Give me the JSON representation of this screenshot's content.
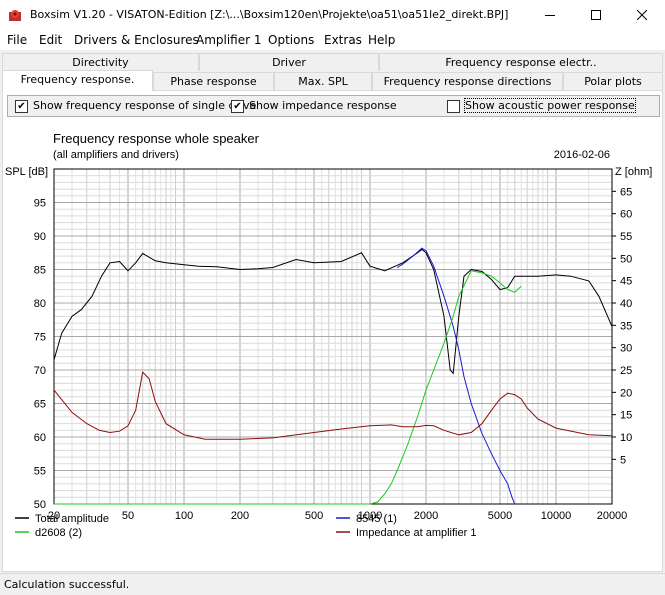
{
  "window": {
    "title": "Boxsim V1.20 - VISATON-Edition [Z:\\...\\Boxsim120en\\Projekte\\oa51\\oa51le2_direkt.BPJ]",
    "minimize": "—",
    "maximize": "☐",
    "close": "✕"
  },
  "menu": {
    "items": [
      {
        "label": "File"
      },
      {
        "label": "Edit"
      },
      {
        "label": "Drivers & Enclosures"
      },
      {
        "label": "Amplifier 1"
      },
      {
        "label": "Options"
      },
      {
        "label": "Extras"
      },
      {
        "label": "Help"
      }
    ]
  },
  "tabs": {
    "row1": [
      {
        "label": "Directivity"
      },
      {
        "label": "Driver"
      },
      {
        "label": "Frequency response electr.."
      }
    ],
    "row2": [
      {
        "label": "Frequency response."
      },
      {
        "label": "Phase response"
      },
      {
        "label": "Max. SPL"
      },
      {
        "label": "Frequency response directions"
      },
      {
        "label": "Polar plots"
      }
    ]
  },
  "options": {
    "single_drive": {
      "label": "Show frequency response of single drive",
      "checked": true
    },
    "impedance": {
      "label": "Show impedance response",
      "checked": true
    },
    "acoustic_power": {
      "label": "Show acoustic power response",
      "checked": false
    }
  },
  "status": {
    "text": "Calculation successful."
  },
  "chart_data": {
    "type": "line",
    "title": "Frequency response whole speaker",
    "subtitle": "(all amplifiers and drivers)",
    "date": "2016-02-06",
    "ylabel": "SPL [dB]",
    "y2label": "Z [ohm]",
    "xscale": "log",
    "xlim": [
      20,
      20000
    ],
    "ylim": [
      50,
      100
    ],
    "y2lim": [
      -5,
      70
    ],
    "grid": true,
    "legend_position": "bottom",
    "x_ticks": [
      "20",
      "50",
      "100",
      "200",
      "500",
      "1000",
      "2000",
      "5000",
      "10000",
      "20000"
    ],
    "y_ticks": [
      "50",
      "55",
      "60",
      "65",
      "70",
      "75",
      "80",
      "85",
      "90",
      "95"
    ],
    "y2_ticks": [
      "5",
      "10",
      "15",
      "20",
      "25",
      "30",
      "35",
      "40",
      "45",
      "50",
      "55",
      "60",
      "65"
    ],
    "series": [
      {
        "name": "Total amplitude",
        "axis": "spl",
        "color": "#000000",
        "x": [
          20,
          22,
          25,
          28,
          32,
          36,
          40,
          45,
          50,
          55,
          60,
          70,
          80,
          100,
          120,
          150,
          200,
          250,
          300,
          400,
          500,
          700,
          900,
          1000,
          1200,
          1500,
          1800,
          1900,
          2000,
          2200,
          2500,
          2700,
          2800,
          3000,
          3200,
          3500,
          4000,
          4500,
          5000,
          5500,
          6000,
          7000,
          8000,
          10000,
          12000,
          15000,
          17000,
          20000
        ],
        "y": [
          71.5,
          75.5,
          78,
          79,
          81,
          84,
          86,
          86.2,
          84.8,
          86,
          87.4,
          86.3,
          86,
          85.7,
          85.5,
          85.4,
          85,
          85.1,
          85.3,
          86.5,
          86,
          86.2,
          87.5,
          85.5,
          84.8,
          86,
          87.5,
          88,
          87.5,
          85,
          78,
          70,
          69.5,
          78,
          84,
          85,
          84.7,
          83.5,
          82,
          82.3,
          84,
          84,
          84,
          84.2,
          84,
          83.3,
          81,
          76.5
        ]
      },
      {
        "name": "8545 (1)",
        "axis": "spl",
        "color": "#1a1ad0",
        "x": [
          1400,
          1500,
          1700,
          1800,
          1900,
          2000,
          2200,
          2500,
          2800,
          3000,
          3200,
          3500,
          4000,
          4500,
          5000,
          5500,
          5800,
          6000
        ],
        "y": [
          85.3,
          85.8,
          87,
          87.6,
          88.2,
          87.8,
          85.5,
          81,
          76.5,
          73,
          69,
          65,
          60.5,
          57.5,
          55,
          53,
          51,
          50
        ]
      },
      {
        "name": "d2608  (2)",
        "axis": "spl",
        "color": "#1ec81e",
        "x": [
          20,
          500,
          1000,
          1100,
          1200,
          1300,
          1400,
          1600,
          1800,
          2000,
          2200,
          2500,
          2800,
          3000,
          3500,
          4000,
          4500,
          5000,
          5500,
          6000,
          6500
        ],
        "y": [
          50,
          50,
          50,
          50.3,
          51.5,
          53,
          55,
          59,
          63,
          67,
          70,
          74,
          78,
          81,
          84.8,
          84.5,
          84,
          83,
          82,
          81.6,
          82.5
        ]
      },
      {
        "name": "Impedance at amplifier 1",
        "axis": "z",
        "color": "#8b1010",
        "x": [
          20,
          25,
          30,
          35,
          40,
          45,
          50,
          55,
          60,
          65,
          70,
          80,
          100,
          130,
          200,
          300,
          500,
          700,
          1000,
          1300,
          1500,
          1800,
          2000,
          2200,
          2500,
          3000,
          3500,
          4000,
          4500,
          5000,
          5500,
          6000,
          6500,
          7000,
          8000,
          10000,
          15000,
          20000
        ],
        "y": [
          20.5,
          15.5,
          13,
          11.5,
          11,
          11.3,
          12.5,
          16,
          24.5,
          23,
          18,
          13,
          10.5,
          9.5,
          9.5,
          9.8,
          11,
          11.8,
          12.5,
          12.7,
          12.3,
          12.3,
          12.6,
          12.5,
          11.5,
          10.5,
          11,
          13,
          16,
          18.5,
          19.8,
          19.5,
          18.5,
          16.5,
          14,
          12,
          10.5,
          10.3
        ]
      }
    ]
  }
}
